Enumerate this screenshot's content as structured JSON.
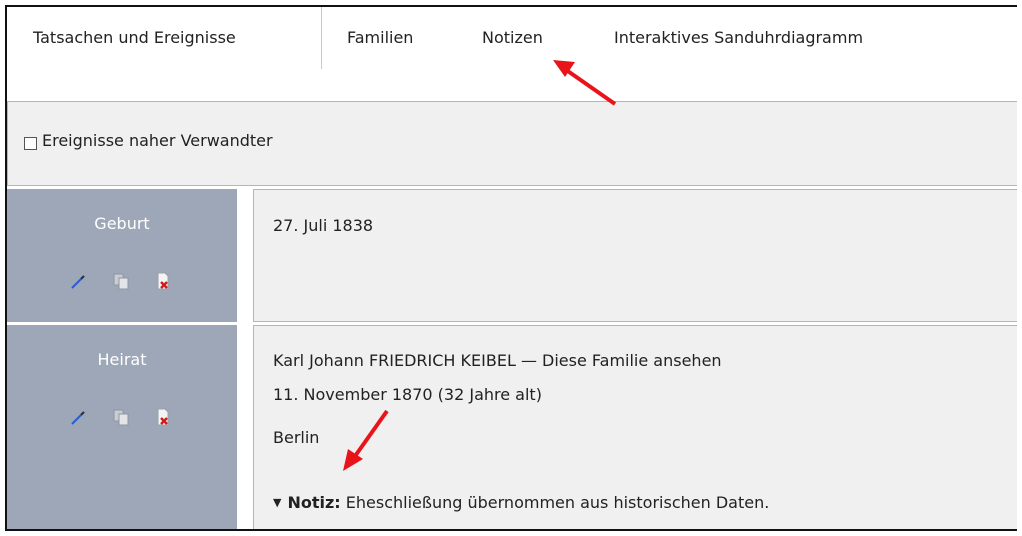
{
  "tabs": {
    "items": [
      {
        "label": "Tatsachen und Ereignisse"
      },
      {
        "label": "Familien"
      },
      {
        "label": "Notizen"
      },
      {
        "label": "Interaktives Sanduhrdiagramm"
      }
    ],
    "active": "Tatsachen und Ereignisse"
  },
  "filter": {
    "checkbox_label": "Ereignisse naher Verwandter",
    "checked": false
  },
  "events": [
    {
      "type": "Geburt",
      "date": "27. Juli 1838",
      "icons": [
        "edit-pen-icon",
        "copy-icon",
        "delete-icon"
      ]
    },
    {
      "type": "Heirat",
      "partner": "Karl Johann FRIEDRICH KEIBEL — Diese Familie ansehen",
      "date": "11. November 1870 (32 Jahre alt)",
      "place": "Berlin",
      "note_label": "Notiz:",
      "note_text": " Eheschließung übernommen aus historischen Daten.",
      "icons": [
        "edit-pen-icon",
        "copy-icon",
        "delete-icon"
      ]
    }
  ],
  "annotation_color": "#e8141a",
  "event_label_bg": "#9ea7b8"
}
